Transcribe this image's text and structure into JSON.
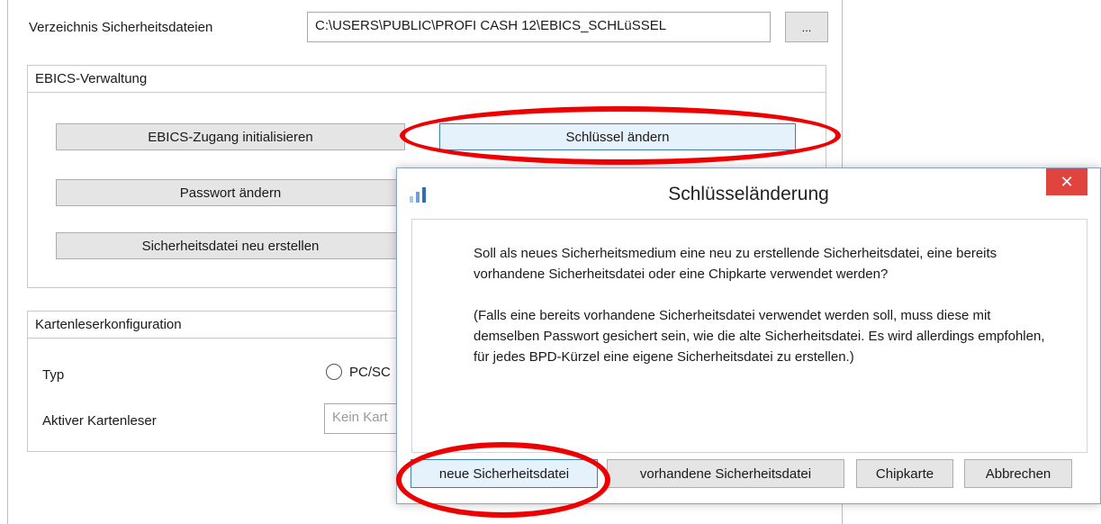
{
  "settings": {
    "security_dir_label": "Verzeichnis Sicherheitsdateien",
    "security_dir_value": "C:\\USERS\\PUBLIC\\PROFI CASH 12\\EBICS_SCHLüSSEL",
    "browse_label": "..."
  },
  "ebics": {
    "group_title": "EBICS-Verwaltung",
    "init_label": "EBICS-Zugang initialisieren",
    "change_key_label": "Schlüssel ändern",
    "change_password_label": "Passwort ändern",
    "recreate_file_label": "Sicherheitsdatei neu erstellen"
  },
  "card_reader": {
    "group_title": "Kartenleserkonfiguration",
    "type_label": "Typ",
    "type_option_pcsc": "PC/SC",
    "active_reader_label": "Aktiver Kartenleser",
    "active_reader_value": "Kein Kart"
  },
  "dialog": {
    "title": "Schlüsseländerung",
    "close_glyph": "✕",
    "message_p1": "Soll als neues Sicherheitsmedium eine neu zu erstellende Sicherheitsdatei, eine bereits vorhandene Sicherheitsdatei oder eine Chipkarte verwendet werden?",
    "message_p2": "(Falls eine bereits vorhandene Sicherheitsdatei verwendet werden soll, muss diese mit demselben Passwort gesichert sein, wie die alte Sicherheitsdatei. Es wird allerdings empfohlen, für jedes BPD-Kürzel eine eigene Sicherheitsdatei zu erstellen.)",
    "btn_new_file": "neue Sicherheitsdatei",
    "btn_existing_file": "vorhandene Sicherheitsdatei",
    "btn_chipcard": "Chipkarte",
    "btn_cancel": "Abbrechen"
  },
  "colors": {
    "highlight": "#ee0000",
    "close_button": "#e0443e",
    "button_face": "#e5e5e5"
  }
}
